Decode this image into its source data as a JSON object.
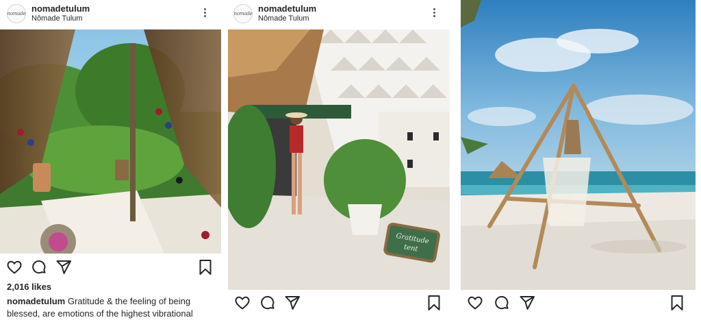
{
  "posts": [
    {
      "username": "nomadetulum",
      "location": "Nômade Tulum",
      "avatar_text": "nomade",
      "likes": "2,016 likes",
      "caption_user": "nomadetulum",
      "caption_text": "Gratitude & the feeling of being blessed, are emotions of the highest vibrational"
    },
    {
      "username": "nomadetulum",
      "location": "Nômade Tulum",
      "avatar_text": "nomade",
      "sign_text": "Gratitude tent"
    },
    {}
  ],
  "icons": [
    "heart-icon",
    "comment-icon",
    "share-icon",
    "bookmark-icon",
    "more-icon"
  ],
  "colors": {
    "text": "#262626",
    "icon": "#262626",
    "sky": "#3d93cf",
    "sand": "#ece7df",
    "palm": "#4f8a3a"
  }
}
